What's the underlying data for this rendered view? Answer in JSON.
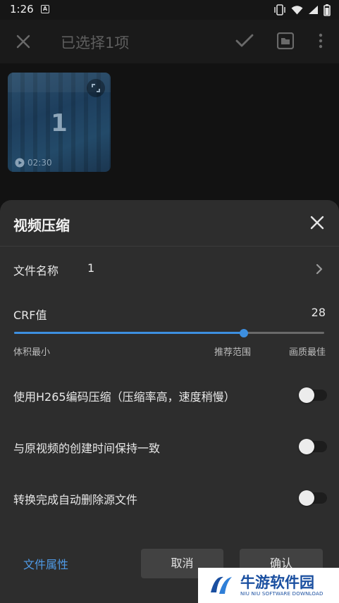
{
  "status_bar": {
    "time": "1:26",
    "notif_letter": "A"
  },
  "toolbar": {
    "title": "已选择1项"
  },
  "thumbnail": {
    "index": "1",
    "duration": "02:30"
  },
  "sheet": {
    "title": "视频压缩",
    "file_name_label": "文件名称",
    "file_name_value": "1",
    "crf_label": "CRF值",
    "crf_value": "28",
    "crf_level": 0.74,
    "scale_min": "体积最小",
    "scale_mid": "推荐范围",
    "scale_max": "画质最佳",
    "toggles": [
      {
        "label": "使用H265编码压缩（压缩率高，速度稍慢）",
        "on": false
      },
      {
        "label": "与原视频的创建时间保持一致",
        "on": false
      },
      {
        "label": "转换完成自动删除源文件",
        "on": false
      }
    ],
    "file_props": "文件属性",
    "cancel": "取消",
    "confirm": "确认"
  },
  "watermark": {
    "title": "牛游软件园",
    "subtitle": "NIU NIU SOFTWARE DOWNLOAD"
  },
  "colors": {
    "accent": "#3d8fe0",
    "sheet_bg": "#2d2d2d",
    "link": "#4f9ae6"
  }
}
